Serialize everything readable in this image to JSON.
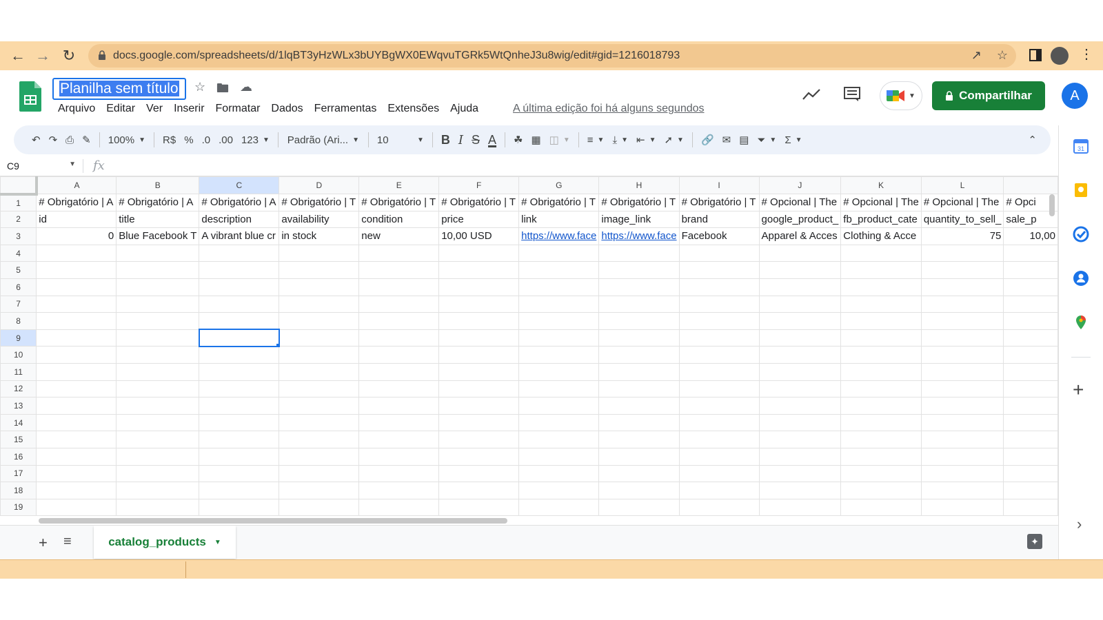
{
  "browser": {
    "url": "docs.google.com/spreadsheets/d/1lqBT3yHzWLx3bUYBgWX0EWqvuTGRk5WtQnheJ3u8wig/edit#gid=1216018793"
  },
  "header": {
    "title": "Planilha sem título",
    "menus": [
      "Arquivo",
      "Editar",
      "Ver",
      "Inserir",
      "Formatar",
      "Dados",
      "Ferramentas",
      "Extensões",
      "Ajuda"
    ],
    "last_edit": "A última edição foi há alguns segundos",
    "share_label": "Compartilhar",
    "avatar": "A"
  },
  "toolbar": {
    "zoom": "100%",
    "currency": "R$",
    "percent": "%",
    "dec_decrease": ".0",
    "dec_increase": ".00",
    "more_formats": "123",
    "font": "Padrão (Ari...",
    "font_size": "10"
  },
  "formula_bar": {
    "cell_ref": "C9",
    "fx": "fx"
  },
  "grid": {
    "columns": [
      "A",
      "B",
      "C",
      "D",
      "E",
      "F",
      "G",
      "H",
      "I",
      "J",
      "K",
      "L",
      ""
    ],
    "rows": [
      [
        "# Obrigatório | A",
        "# Obrigatório | A",
        "# Obrigatório | A",
        "# Obrigatório | T",
        "# Obrigatório | T",
        "# Obrigatório | T",
        "# Obrigatório | T",
        "# Obrigatório | T",
        "# Obrigatório | T",
        "# Opcional | The",
        "# Opcional | The",
        "# Opcional | The",
        "# Opci"
      ],
      [
        "id",
        "title",
        "description",
        "availability",
        "condition",
        "price",
        "link",
        "image_link",
        "brand",
        "google_product_",
        "fb_product_cate",
        "quantity_to_sell_",
        "sale_p"
      ],
      [
        "0",
        "Blue Facebook T",
        "A vibrant blue cr",
        "in stock",
        "new",
        "10,00 USD",
        "https://www.face",
        "https://www.face",
        "Facebook",
        "Apparel & Acces",
        "Clothing & Acce",
        "75",
        "10,00"
      ]
    ],
    "row_numbers": [
      "1",
      "2",
      "3",
      "4",
      "5",
      "6",
      "7",
      "8",
      "9",
      "10",
      "11",
      "12",
      "13",
      "14",
      "15",
      "16",
      "17",
      "18",
      "19"
    ],
    "selected_cell": "C9"
  },
  "sheets": {
    "active_tab": "catalog_products"
  }
}
